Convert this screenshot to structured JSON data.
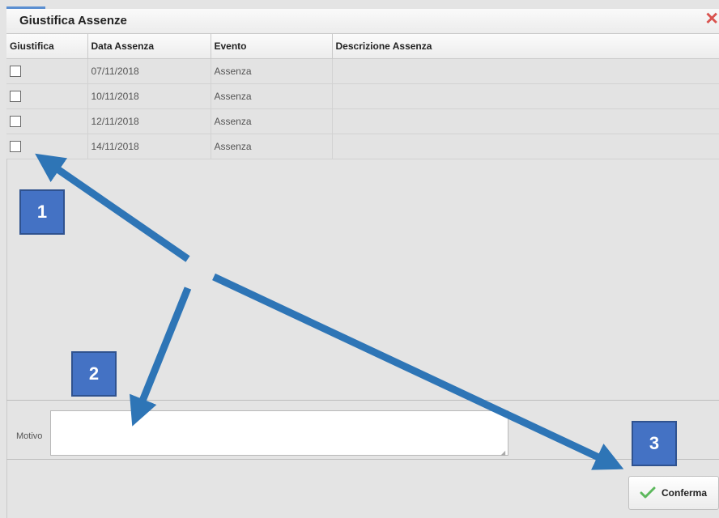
{
  "dialog": {
    "title": "Giustifica Assenze",
    "close_icon": "close-icon",
    "accent_color": "#5b8fd1",
    "close_color": "#d9534f"
  },
  "table": {
    "headers": [
      "Giustifica",
      "Data Assenza",
      "Evento",
      "Descrizione Assenza"
    ],
    "rows": [
      {
        "checked": false,
        "date": "07/11/2018",
        "event": "Assenza",
        "description": ""
      },
      {
        "checked": false,
        "date": "10/11/2018",
        "event": "Assenza",
        "description": ""
      },
      {
        "checked": false,
        "date": "12/11/2018",
        "event": "Assenza",
        "description": ""
      },
      {
        "checked": false,
        "date": "14/11/2018",
        "event": "Assenza",
        "description": ""
      }
    ]
  },
  "motivo": {
    "label": "Motivo",
    "value": ""
  },
  "confirm": {
    "label": "Conferma",
    "icon": "check-icon",
    "icon_color": "#5cb85c"
  },
  "annotations": {
    "color": "#2e75b6",
    "badge_color": "#4472c4",
    "badges": [
      "1",
      "2",
      "3"
    ]
  }
}
